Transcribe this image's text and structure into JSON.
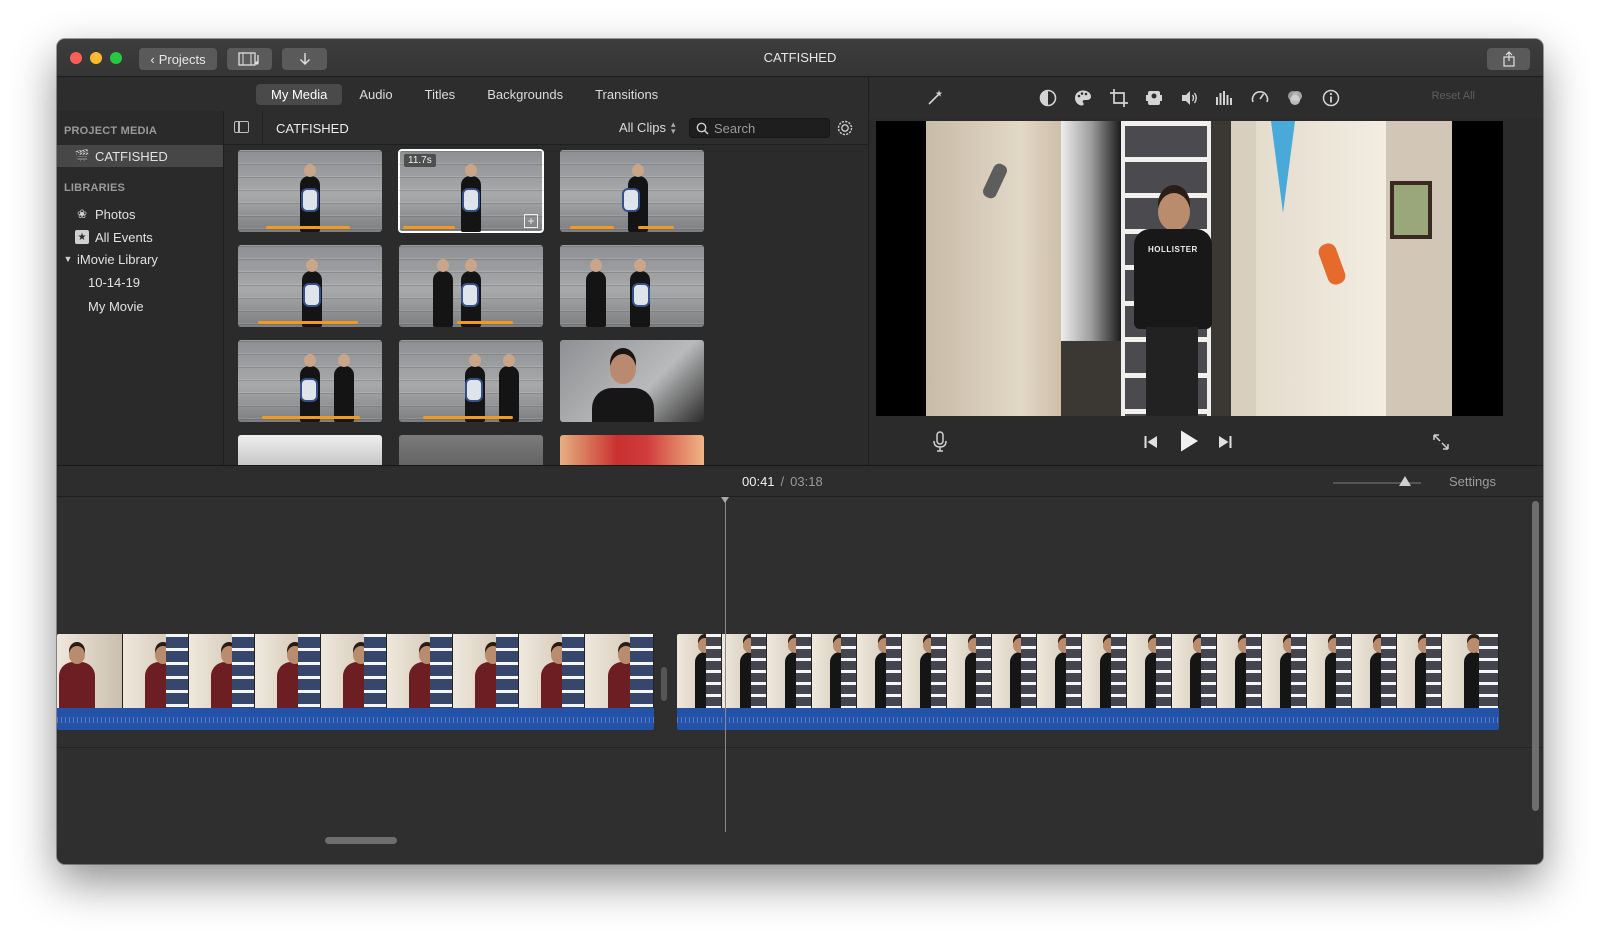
{
  "window": {
    "title": "CATFISHED",
    "projects_label": "Projects"
  },
  "browser_tabs": [
    "My Media",
    "Audio",
    "Titles",
    "Backgrounds",
    "Transitions"
  ],
  "sidebar": {
    "project_media_heading": "PROJECT MEDIA",
    "project_item": "CATFISHED",
    "libraries_heading": "LIBRARIES",
    "items": [
      {
        "label": "Photos",
        "icon": "photos-icon"
      },
      {
        "label": "All Events",
        "icon": "star-icon"
      },
      {
        "label": "iMovie Library",
        "icon": "disclosure-triangle-icon"
      },
      {
        "label": "10-14-19",
        "icon": ""
      },
      {
        "label": "My Movie",
        "icon": ""
      }
    ]
  },
  "browser": {
    "title": "CATFISHED",
    "filter_label": "All Clips",
    "search_placeholder": "Search",
    "selected_clip_duration": "11.7s"
  },
  "viewer": {
    "reset_all_label": "Reset All",
    "shirt_text": "HOLLISTER"
  },
  "timeline": {
    "current_time": "00:41",
    "separator": "/",
    "total_time": "03:18",
    "settings_label": "Settings"
  },
  "colors": {
    "window_bg": "#2b2b2b",
    "accent_orange": "#f29a1d",
    "audio_blue": "#2352a8"
  }
}
